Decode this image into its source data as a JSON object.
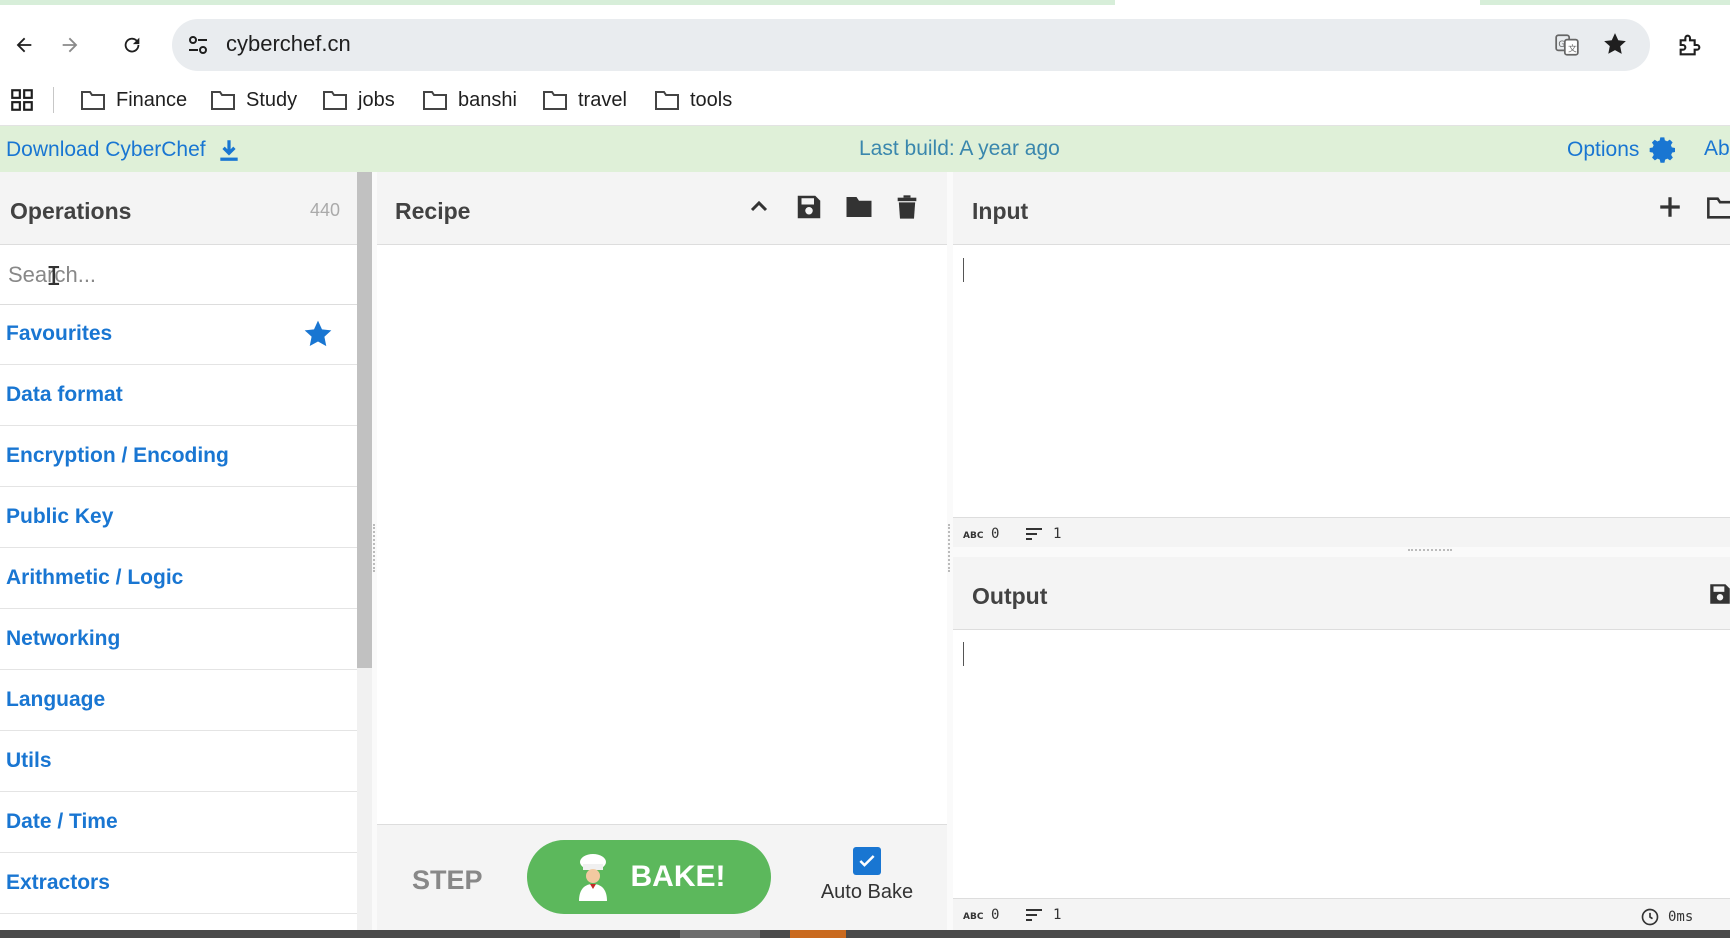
{
  "browser": {
    "url": "cyberchef.cn",
    "bookmarks": [
      "Finance",
      "Study",
      "jobs",
      "banshi",
      "travel",
      "tools"
    ]
  },
  "banner": {
    "download_label": "Download CyberChef",
    "last_build": "Last build: A year ago",
    "options_label": "Options",
    "about_label": "Ab"
  },
  "operations": {
    "title": "Operations",
    "count": "440",
    "search_placeholder": "Search...",
    "categories": [
      "Favourites",
      "Data format",
      "Encryption / Encoding",
      "Public Key",
      "Arithmetic / Logic",
      "Networking",
      "Language",
      "Utils",
      "Date / Time",
      "Extractors"
    ]
  },
  "recipe": {
    "title": "Recipe",
    "step_label": "STEP",
    "bake_label": "BAKE!",
    "auto_bake_label": "Auto Bake",
    "auto_bake_checked": true
  },
  "input": {
    "title": "Input",
    "length": "0",
    "lines": "1"
  },
  "output": {
    "title": "Output",
    "length": "0",
    "lines": "1",
    "time": "0ms"
  },
  "colors": {
    "accent": "#1976d2",
    "banner_bg": "#dff0d8",
    "bake_green": "#5cb85c"
  }
}
